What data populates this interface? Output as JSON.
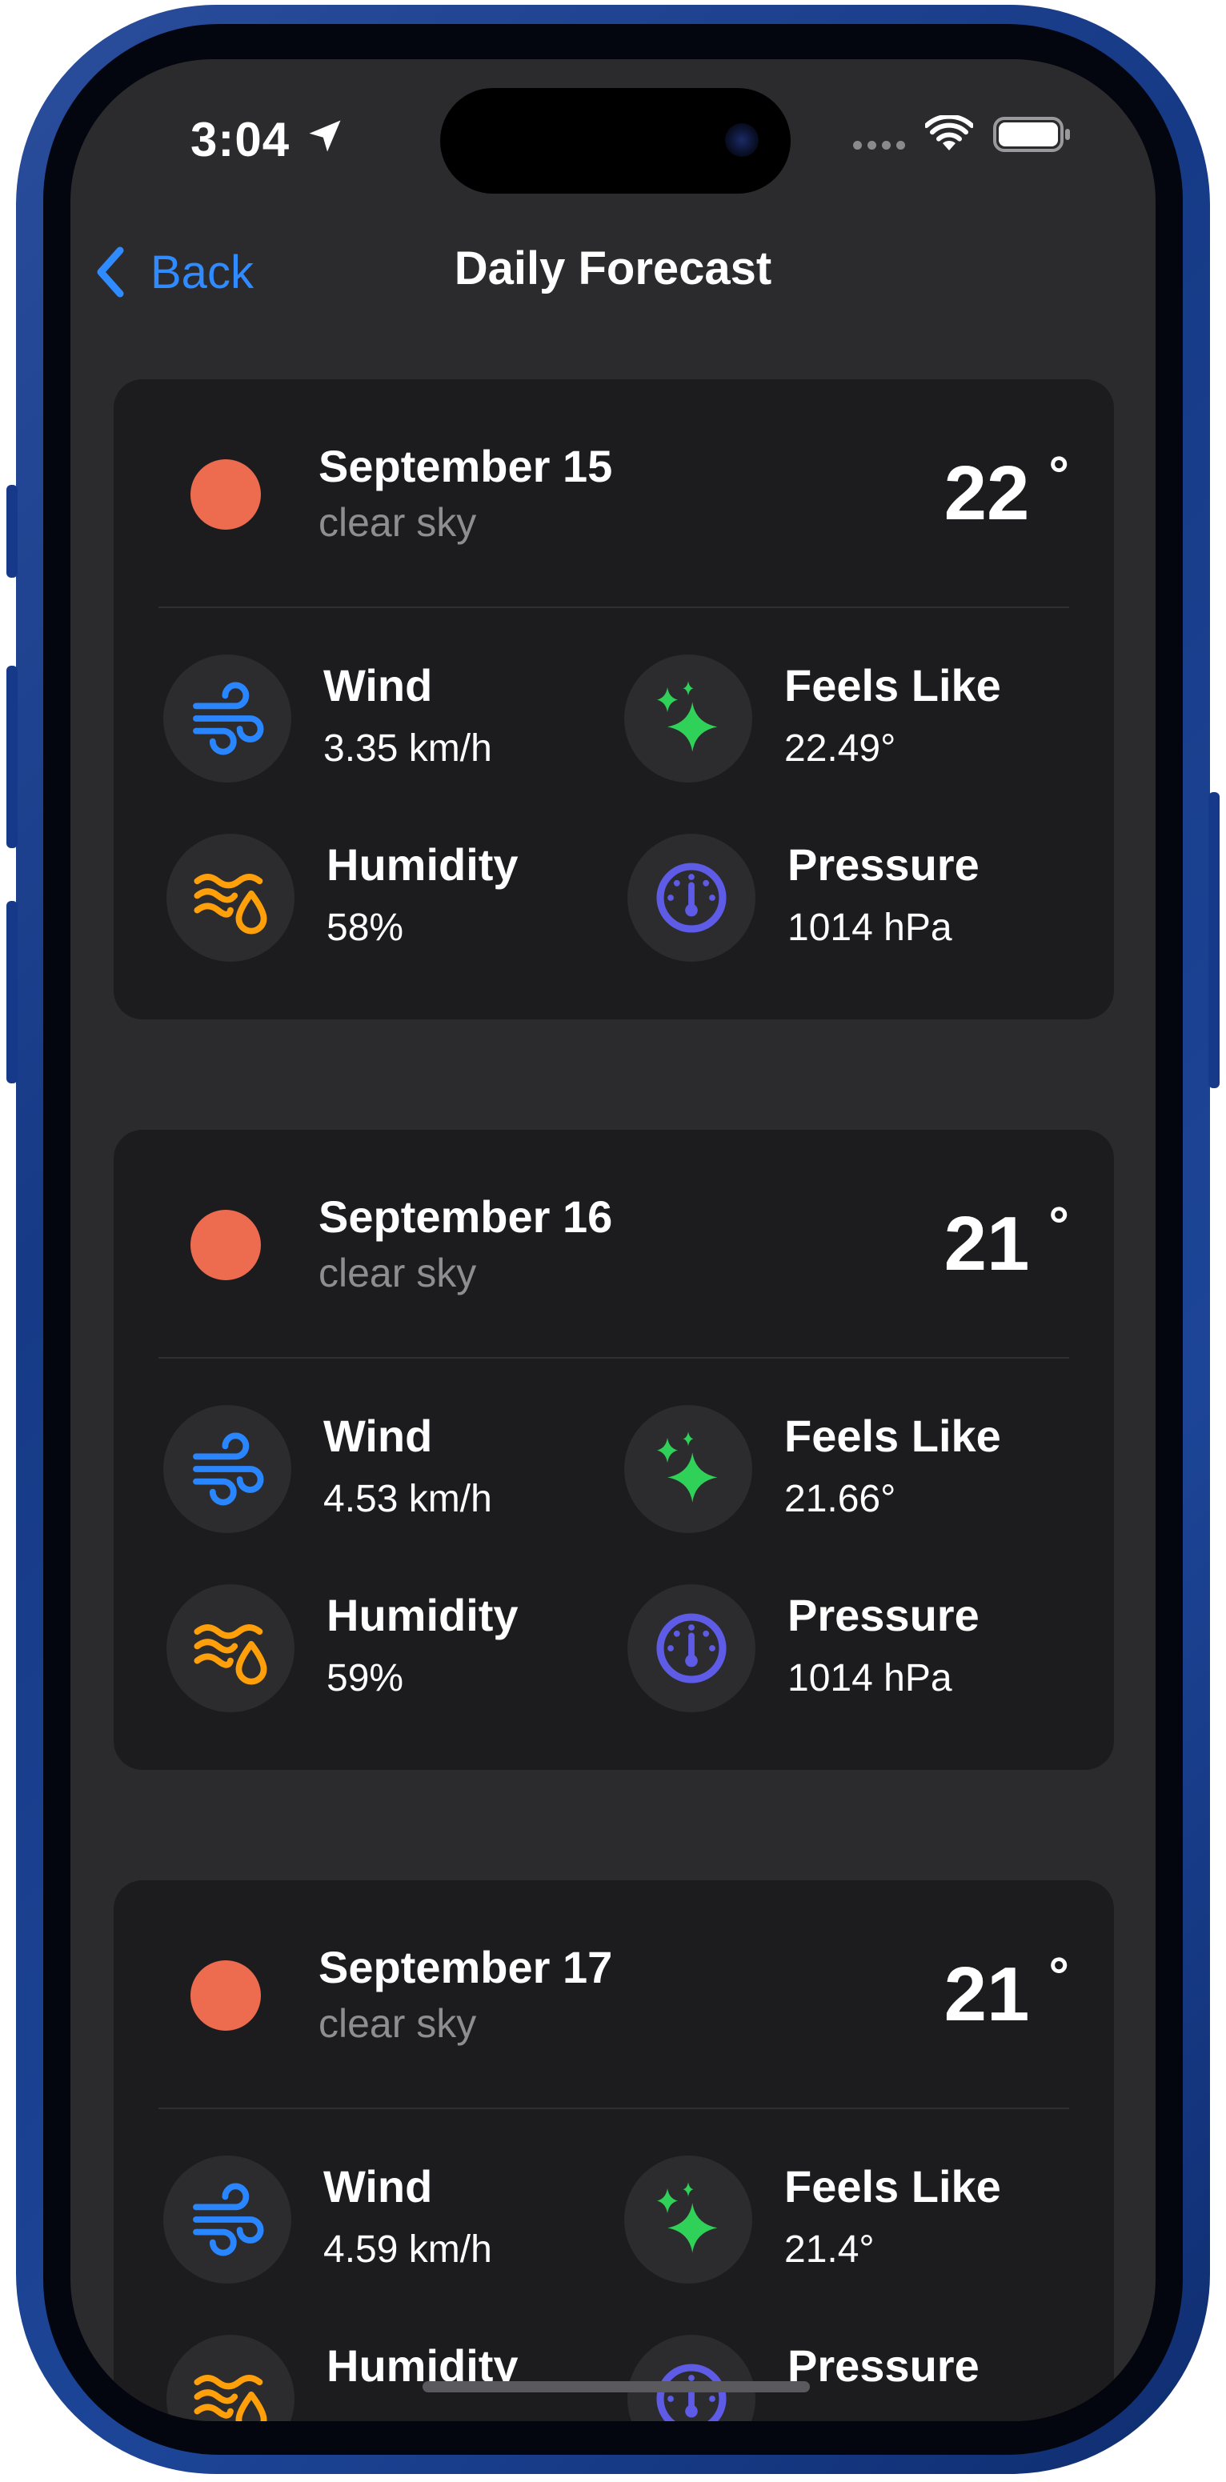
{
  "status_bar": {
    "time": "3:04"
  },
  "nav": {
    "back_label": "Back",
    "title": "Daily Forecast"
  },
  "forecast": [
    {
      "date": "September 15",
      "description": "clear sky",
      "temp": "22",
      "degree_symbol": "°",
      "wind_label": "Wind",
      "wind_value": "3.35 km/h",
      "feels_label": "Feels Like",
      "feels_value": "22.49°",
      "humidity_label": "Humidity",
      "humidity_value": "58%",
      "pressure_label": "Pressure",
      "pressure_value": "1014 hPa"
    },
    {
      "date": "September 16",
      "description": "clear sky",
      "temp": "21",
      "degree_symbol": "°",
      "wind_label": "Wind",
      "wind_value": "4.53 km/h",
      "feels_label": "Feels Like",
      "feels_value": "21.66°",
      "humidity_label": "Humidity",
      "humidity_value": "59%",
      "pressure_label": "Pressure",
      "pressure_value": "1014 hPa"
    },
    {
      "date": "September 17",
      "description": "clear sky",
      "temp": "21",
      "degree_symbol": "°",
      "wind_label": "Wind",
      "wind_value": "4.59 km/h",
      "feels_label": "Feels Like",
      "feels_value": "21.4°",
      "humidity_label": "Humidity",
      "humidity_value": "",
      "pressure_label": "Pressure",
      "pressure_value": ""
    }
  ],
  "colors": {
    "accent": "#2f8bff",
    "sun": "#ed6b4f",
    "wind_icon": "#2a86ff",
    "feels_icon": "#30d158",
    "humidity_icon": "#ff9f0a",
    "pressure_icon": "#5e5ce6",
    "card_bg": "#1c1c1e",
    "screen_bg": "#2b2b2d"
  },
  "icons": [
    "location-arrow-icon",
    "wifi-icon",
    "battery-icon",
    "chevron-left-icon",
    "sun-icon",
    "wind-icon",
    "sparkles-icon",
    "humidity-icon",
    "gauge-icon"
  ]
}
